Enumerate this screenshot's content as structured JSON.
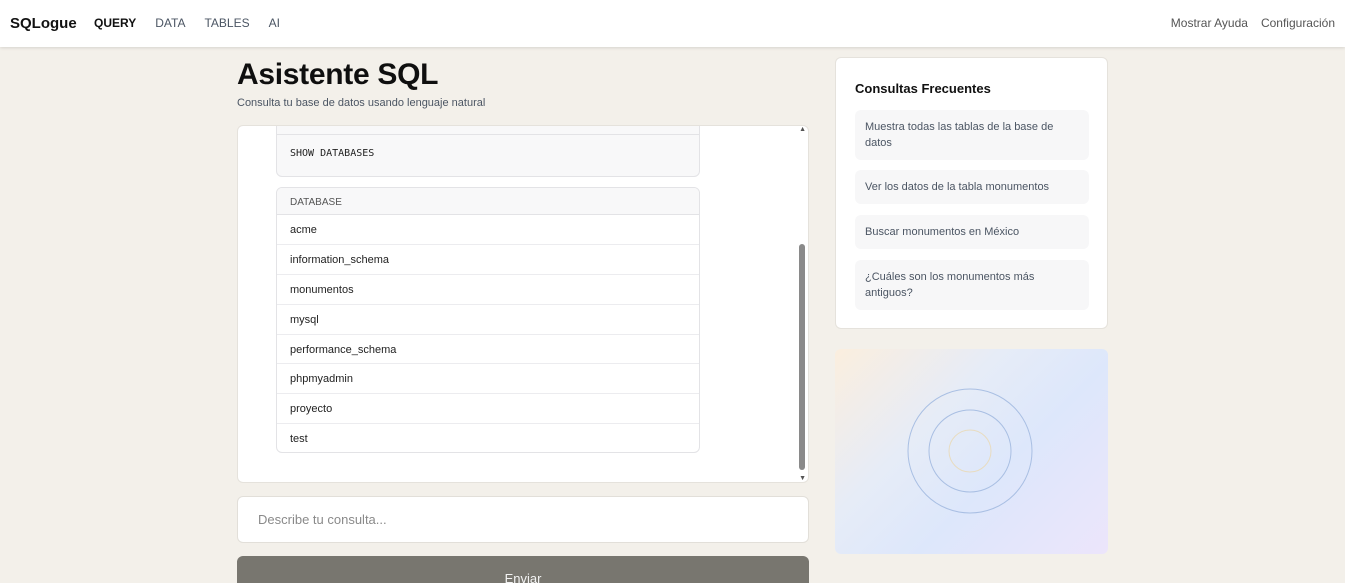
{
  "brand": "SQLogue",
  "nav": [
    {
      "label": "QUERY",
      "active": true
    },
    {
      "label": "DATA",
      "active": false
    },
    {
      "label": "TABLES",
      "active": false
    },
    {
      "label": "AI",
      "active": false
    }
  ],
  "top_links": {
    "help": "Mostrar Ayuda",
    "settings": "Configuración"
  },
  "page": {
    "title": "Asistente SQL",
    "subtitle": "Consulta tu base de datos usando lenguaje natural"
  },
  "chat": {
    "sql_query": "SHOW DATABASES",
    "result": {
      "column": "DATABASE",
      "rows": [
        "acme",
        "information_schema",
        "monumentos",
        "mysql",
        "performance_schema",
        "phpmyadmin",
        "proyecto",
        "test"
      ]
    }
  },
  "input": {
    "placeholder": "Describe tu consulta...",
    "value": ""
  },
  "send_label": "Enviar",
  "faq": {
    "title": "Consultas Frecuentes",
    "items": [
      "Muestra todas las tablas de la base de datos",
      "Ver los datos de la tabla monumentos",
      "Buscar monumentos en México",
      "¿Cuáles son los monumentos más antiguos?"
    ]
  },
  "colors": {
    "background": "#f3f0ea",
    "send_button": "#78766f",
    "ring_stroke": "#a9bfe3"
  },
  "icons": {
    "scroll_up": "triangle-up-icon",
    "scroll_down": "triangle-down-icon",
    "decoration": "concentric-circles-icon"
  }
}
